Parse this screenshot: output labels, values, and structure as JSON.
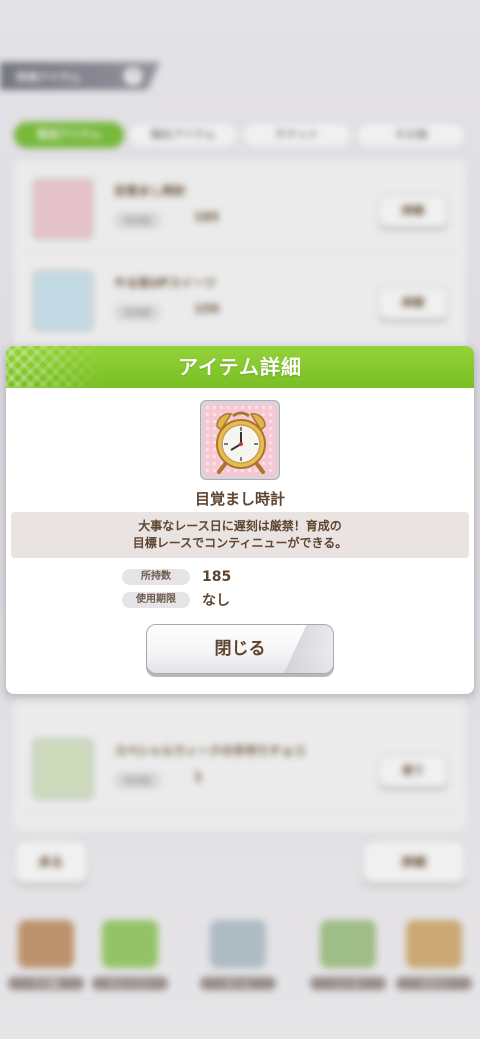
{
  "background": {
    "header_title": "所持アイテム",
    "tabs": [
      {
        "label": "育成アイテム",
        "active": true
      },
      {
        "label": "強化アイテム",
        "active": false
      },
      {
        "label": "チケット",
        "active": false
      },
      {
        "label": "その他",
        "active": false
      }
    ],
    "items": [
      {
        "name": "目覚まし時計",
        "qty_label": "所持数",
        "qty": "185",
        "button": "詳細"
      },
      {
        "name": "やる気UPスイーツ",
        "qty_label": "所持数",
        "qty": "159",
        "button": "詳細"
      },
      {
        "name": "スペシャルウィークの手作りチョコ",
        "qty_label": "所持数",
        "qty": "1",
        "button": "使う"
      }
    ],
    "back_label": "戻る",
    "next_label": "詳細",
    "nav": [
      "ウマ娘",
      "ストーリー",
      "ホーム",
      "レース",
      "ガチャ"
    ]
  },
  "dialog": {
    "title": "アイテム詳細",
    "item_name": "目覚まし時計",
    "description_line1": "大事なレース日に遅刻は厳禁！育成の",
    "description_line2": "目標レースでコンティニューができる。",
    "stats": [
      {
        "label": "所持数",
        "value": "185"
      },
      {
        "label": "使用期限",
        "value": "なし"
      }
    ],
    "close_label": "閉じる",
    "icon": "alarm-clock-icon",
    "accent_color": "#7cc23a"
  }
}
